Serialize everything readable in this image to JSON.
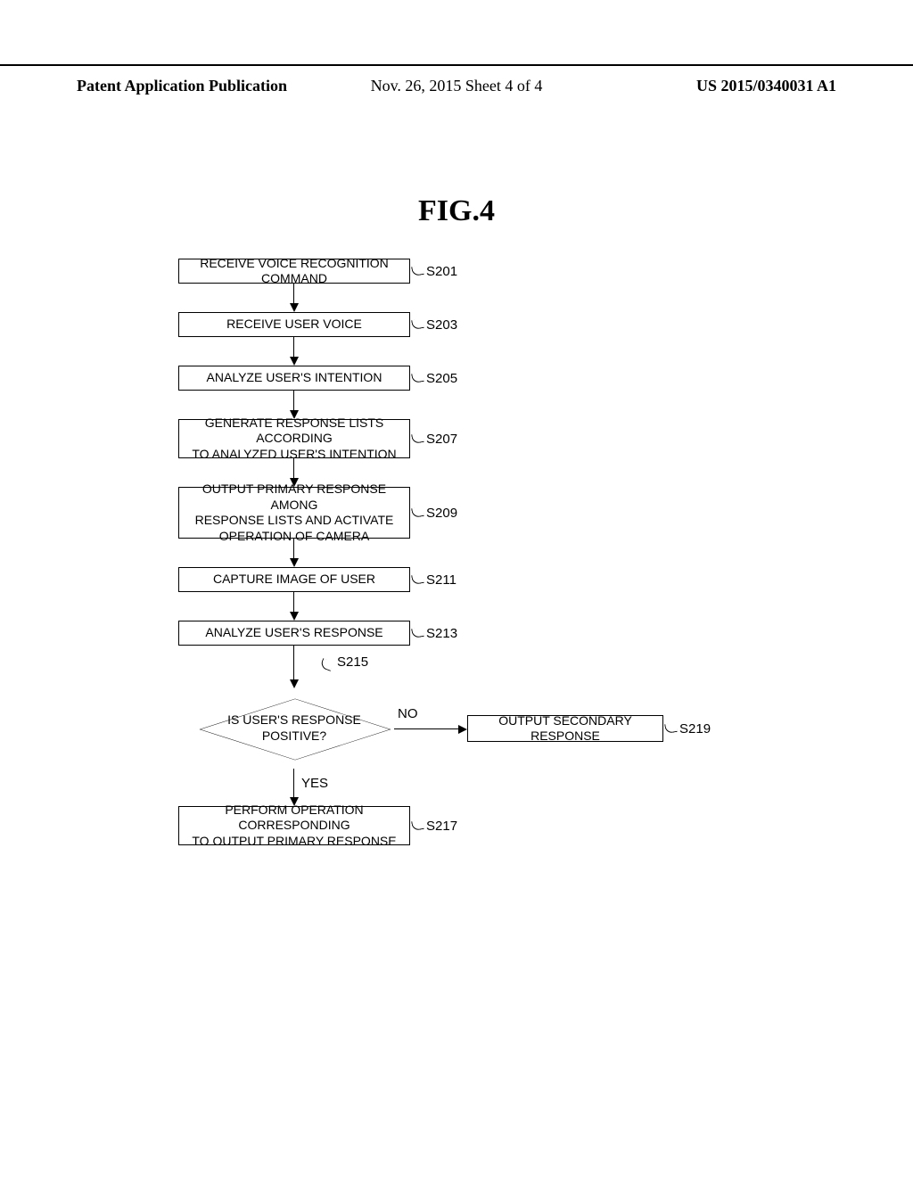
{
  "header": {
    "left_bold": "Patent Application Publication",
    "center": "Nov. 26, 2015  Sheet 4 of 4",
    "right_bold": "US 2015/0340031 A1"
  },
  "figure_title": "FIG.4",
  "steps": {
    "s201": {
      "label": "S201",
      "text": "RECEIVE VOICE RECOGNITION COMMAND"
    },
    "s203": {
      "label": "S203",
      "text": "RECEIVE USER VOICE"
    },
    "s205": {
      "label": "S205",
      "text": "ANALYZE USER'S INTENTION"
    },
    "s207": {
      "label": "S207",
      "text": "GENERATE RESPONSE LISTS ACCORDING\nTO ANALYZED USER'S INTENTION"
    },
    "s209": {
      "label": "S209",
      "text": "OUTPUT PRIMARY RESPONSE AMONG\nRESPONSE LISTS AND ACTIVATE\nOPERATION OF CAMERA"
    },
    "s211": {
      "label": "S211",
      "text": "CAPTURE IMAGE OF USER"
    },
    "s213": {
      "label": "S213",
      "text": "ANALYZE USER'S RESPONSE"
    },
    "s215": {
      "label": "S215",
      "text": "IS USER'S RESPONSE\nPOSITIVE?",
      "yes": "YES",
      "no": "NO"
    },
    "s217": {
      "label": "S217",
      "text": "PERFORM OPERATION CORRESPONDING\nTO OUTPUT PRIMARY RESPONSE"
    },
    "s219": {
      "label": "S219",
      "text": "OUTPUT SECONDARY RESPONSE"
    }
  }
}
